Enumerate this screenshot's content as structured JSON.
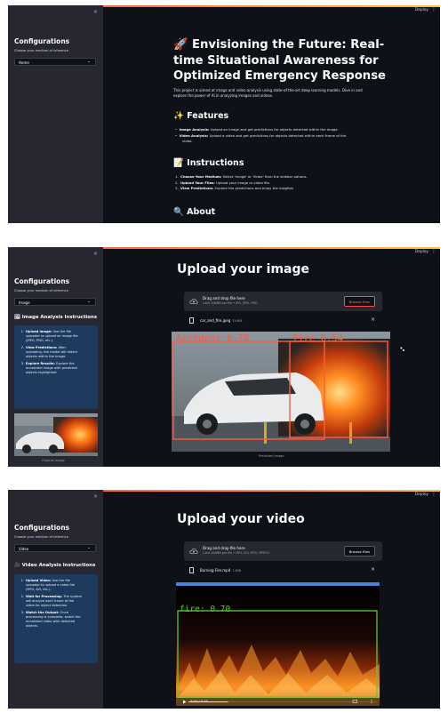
{
  "app": {
    "deploy_label": "Deploy",
    "close_glyph": "×",
    "menu_glyph": "⋮"
  },
  "screen1": {
    "sidebar": {
      "title": "Configurations",
      "medium_label": "Choose your medium of inference",
      "medium_value": "Home"
    },
    "hero": {
      "icon": "🚀",
      "title_lines": [
        "Envisioning the Future: Real-",
        "time Situational Awareness for",
        "Optimized Emergency Response"
      ],
      "intro_lines": [
        "This project is aimed at image and video analysis using state-of-the-art deep learning models. Dive in and",
        "explore the power of AI in analyzing images and videos."
      ]
    },
    "features": {
      "icon": "✨",
      "heading": "Features",
      "items": [
        {
          "label": "Image Analysis:",
          "text": " Upload an image and get predictions for objects detected within the image."
        },
        {
          "label": "Video Analysis:",
          "text": " Upload a video and get predictions for objects detected within each frame of the"
        }
      ],
      "continuation": "video."
    },
    "instructions": {
      "icon": "📝",
      "heading": "Instructions",
      "items": [
        {
          "num": "1.",
          "label": "Choose Your Medium:",
          "text": " Select 'Image' or 'Video' from the sidebar options."
        },
        {
          "num": "2.",
          "label": "Upload Your Files:",
          "text": " Upload your image or video file."
        },
        {
          "num": "3.",
          "label": "View Predictions:",
          "text": " Explore the predictions and enjoy the insights!"
        }
      ]
    },
    "about": {
      "icon": "🔍",
      "heading": "About"
    }
  },
  "screen2": {
    "sidebar": {
      "title": "Configurations",
      "medium_label": "Choose your medium of inference",
      "medium_value": "Image",
      "instructions_icon": "🖼",
      "instructions_heading": "Image Analysis Instructions",
      "steps": [
        {
          "num": "1.",
          "label": "Upload Image:",
          "lines": [
            " Use the file",
            "uploader to upload an image file",
            "(JPEG, PNG, etc.)."
          ]
        },
        {
          "num": "2.",
          "label": "View Predictions:",
          "lines": [
            " After",
            "uploading, the model will detect",
            "objects within the image."
          ]
        },
        {
          "num": "3.",
          "label": "Explore Results:",
          "lines": [
            " Explore the",
            "annotated image with predicted",
            "objects highlighted."
          ]
        }
      ],
      "original_caption": "Original Image"
    },
    "main": {
      "title": "Upload your image",
      "drop_text": "Drag and drop file here",
      "limit_text": "Limit 200MB per file • JPG, JPEG, PNG",
      "browse_label": "Browse files",
      "file_name": "car_and_fire.jpeg",
      "file_size": "33.6KB",
      "predicted_caption": "Predicted Image",
      "detections": [
        {
          "label": "Accident 0.70",
          "color": "#ff5a3c"
        },
        {
          "label": "fire 0.54",
          "color": "#ff5a3c"
        }
      ]
    }
  },
  "screen3": {
    "sidebar": {
      "title": "Configurations",
      "medium_label": "Choose your medium of inference",
      "medium_value": "Video",
      "instructions_icon": "🎥",
      "instructions_heading": "Video Analysis Instructions",
      "steps": [
        {
          "num": "1.",
          "label": "Upload Video:",
          "lines": [
            " Use the file",
            "uploader to upload a video file",
            "(MP4, AVI, etc.)."
          ]
        },
        {
          "num": "2.",
          "label": "Wait for Processing:",
          "lines": [
            " The system",
            "will analyze each frame of the",
            "video for object detection."
          ]
        },
        {
          "num": "3.",
          "label": "Watch the Output:",
          "lines": [
            " Once",
            "processing is complete, watch the",
            "annotated video with detected",
            "objects."
          ]
        }
      ]
    },
    "main": {
      "title": "Upload your video",
      "drop_text": "Drag and drop file here",
      "limit_text": "Limit 200MB per file • MP4, AVI, MOV, MPEG4",
      "browse_label": "Browse files",
      "file_name": "Burning Fire.mp4",
      "file_size": "1.4MB",
      "detection": {
        "label": "fire: 0.70",
        "color": "#4fd13a"
      },
      "player": {
        "time": "0:04 / 0:19",
        "progress": 0.21
      }
    }
  }
}
